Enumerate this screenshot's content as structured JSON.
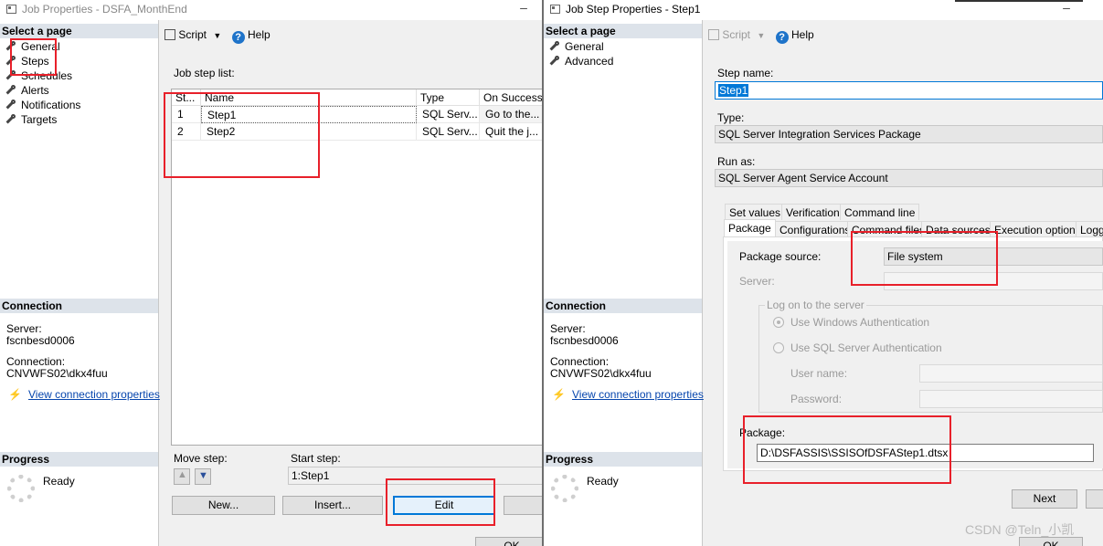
{
  "left_window": {
    "title": "Job Properties - DSFA_MonthEnd",
    "select_page_header": "Select a page",
    "pages": [
      "General",
      "Steps",
      "Schedules",
      "Alerts",
      "Notifications",
      "Targets"
    ],
    "toolbar": {
      "script_label": "Script",
      "help_label": "Help"
    },
    "job_step_list_label": "Job step list:",
    "columns": [
      "St...",
      "Name",
      "Type",
      "On Success"
    ],
    "rows": [
      {
        "step": "1",
        "name": "Step1",
        "type": "SQL Serv...",
        "on_success": "Go to the..."
      },
      {
        "step": "2",
        "name": "Step2",
        "type": "SQL Serv...",
        "on_success": "Quit the j..."
      }
    ],
    "connection_header": "Connection",
    "server_label": "Server:",
    "server_value": "fscnbesd0006",
    "connection_label": "Connection:",
    "connection_value": "CNVWFS02\\dkx4fuu",
    "view_connection_link": "View connection properties",
    "progress_header": "Progress",
    "progress_status": "Ready",
    "move_step_label": "Move step:",
    "start_step_label": "Start step:",
    "start_step_value": "1:Step1",
    "buttons": {
      "new": "New...",
      "insert": "Insert...",
      "edit": "Edit",
      "ok": "OK"
    }
  },
  "right_window": {
    "title": "Job Step Properties - Step1",
    "select_page_header": "Select a page",
    "pages": [
      "General",
      "Advanced"
    ],
    "toolbar": {
      "script_label": "Script",
      "help_label": "Help"
    },
    "step_name_label": "Step name:",
    "step_name_value": "Step1",
    "type_label": "Type:",
    "type_value": "SQL Server Integration Services Package",
    "run_as_label": "Run as:",
    "run_as_value": "SQL Server Agent Service Account",
    "tabs_row1": [
      "Set values",
      "Verification",
      "Command line"
    ],
    "tabs_row2": [
      "Package",
      "Configurations",
      "Command files",
      "Data sources",
      "Execution options",
      "Logg"
    ],
    "package_source_label": "Package source:",
    "package_source_value": "File system",
    "server_label": "Server:",
    "logon_group": "Log on to the server",
    "windows_auth": "Use Windows Authentication",
    "sql_auth": "Use SQL Server Authentication",
    "user_name_label": "User name:",
    "password_label": "Password:",
    "package_label": "Package:",
    "package_value": "D:\\DSFASSIS\\SSISOfDSFAStep1.dtsx",
    "connection_header": "Connection",
    "server_conn_label": "Server:",
    "server_conn_value": "fscnbesd0006",
    "connection_label": "Connection:",
    "connection_value": "CNVWFS02\\dkx4fuu",
    "view_connection_link": "View connection properties",
    "progress_header": "Progress",
    "progress_status": "Ready",
    "buttons": {
      "next": "Next",
      "ok": "OK"
    }
  },
  "watermark": "CSDN @Teln_小凯",
  "colors": {
    "highlight": "#e8202a",
    "selection": "#0078d7",
    "section_header": "#dde3ea"
  }
}
